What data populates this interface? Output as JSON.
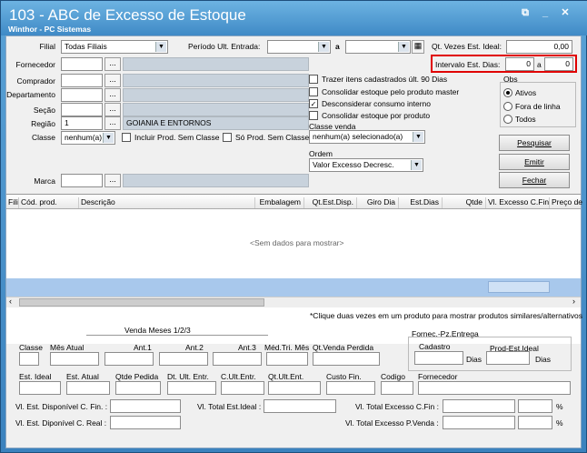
{
  "window": {
    "title": "103 - ABC de Excesso de Estoque",
    "subtitle": "Winthor - PC Sistemas"
  },
  "filters": {
    "filial_label": "Filial",
    "filial_value": "Todas Filiais",
    "periodo_label": "Período Ult. Entrada:",
    "periodo_a": "a",
    "qt_vezes_label": "Qt. Vezes Est. Ideal:",
    "qt_vezes_value": "0,00",
    "intervalo_label": "Intervalo Est. Dias:",
    "intervalo_from": "0",
    "intervalo_a": "a",
    "intervalo_to": "0",
    "fornecedor_label": "Fornecedor",
    "comprador_label": "Comprador",
    "departamento_label": "Departamento",
    "secao_label": "Seção",
    "regiao_label": "Região",
    "regiao_code": "1",
    "regiao_desc": "GOIANIA E ENTORNOS",
    "classe_label": "Classe",
    "classe_value": "nenhum(a)",
    "incluir_label": "Incluir Prod. Sem Classe",
    "so_label": "Só Prod. Sem Classe",
    "marca_label": "Marca",
    "ellipsis": "..."
  },
  "options": {
    "trazer": "Trazer itens cadastrados últ. 90 Dias",
    "consolidar_master": "Consolidar estoque pelo produto master",
    "desconsiderar": "Desconsiderar consumo interno",
    "consolidar_porprod": "Consolidar estoque por produto",
    "classe_venda_label": "Classe venda",
    "classe_venda_value": "nenhum(a) selecionado(a)",
    "ordem_label": "Ordem",
    "ordem_value": "Valor Excesso Decresc.",
    "checkmark": "✓"
  },
  "obs": {
    "label": "Obs",
    "ativos": "Ativos",
    "fora": "Fora de linha",
    "todos": "Todos"
  },
  "buttons": {
    "pesquisar": "Pesquisar",
    "emitir": "Emitir",
    "fechar": "Fechar"
  },
  "grid": {
    "columns": [
      "Fili",
      "Cód. prod.",
      "Descrição",
      "Embalagem",
      "Qt.Est.Disp.",
      "Giro Dia",
      "Est.Dias",
      "Qtde",
      "Vl. Excesso C.Fin",
      "Preço de"
    ],
    "empty": "<Sem dados para mostrar>",
    "hint": "*Clique duas vezes em um produto para mostrar produtos similares/alternativos"
  },
  "details": {
    "venda_meses": "Venda Meses 1/2/3",
    "classe": "Classe",
    "mes_atual": "Mês Atual",
    "ant1": "Ant.1",
    "ant2": "Ant.2",
    "ant3": "Ant.3",
    "med_tri": "Méd.Tri. Mês",
    "qt_venda_perdida": "Qt.Venda Perdida",
    "fornec_entrega": "Fornec.-Pz.Entrega",
    "cadastro": "Cadastro",
    "prod_est_ideal": "Prod-Est.Ideal",
    "dias": "Dias",
    "est_ideal": "Est. Ideal",
    "est_atual": "Est. Atual",
    "qtde_pedida": "Qtde Pedida",
    "dt_ult_entr": "Dt. Ult. Entr.",
    "c_ult_entr": "C.Ult.Entr.",
    "qt_ult_ent": "Qt.Ult.Ent.",
    "custo_fin": "Custo Fin.",
    "codigo": "Codigo",
    "fornecedor": "Fornecedor",
    "vl_disp_cfin": "Vl. Est. Disponível C. Fin. :",
    "vl_disp_creal": "Vl. Est. Diponível C. Real :",
    "vl_total_ideal": "Vl. Total Est.Ideal :",
    "vl_total_exc_cfin": "Vl. Total Excesso C.Fin :",
    "vl_total_exc_pvenda": "Vl. Total Excesso P.Venda :",
    "pct": "%"
  }
}
